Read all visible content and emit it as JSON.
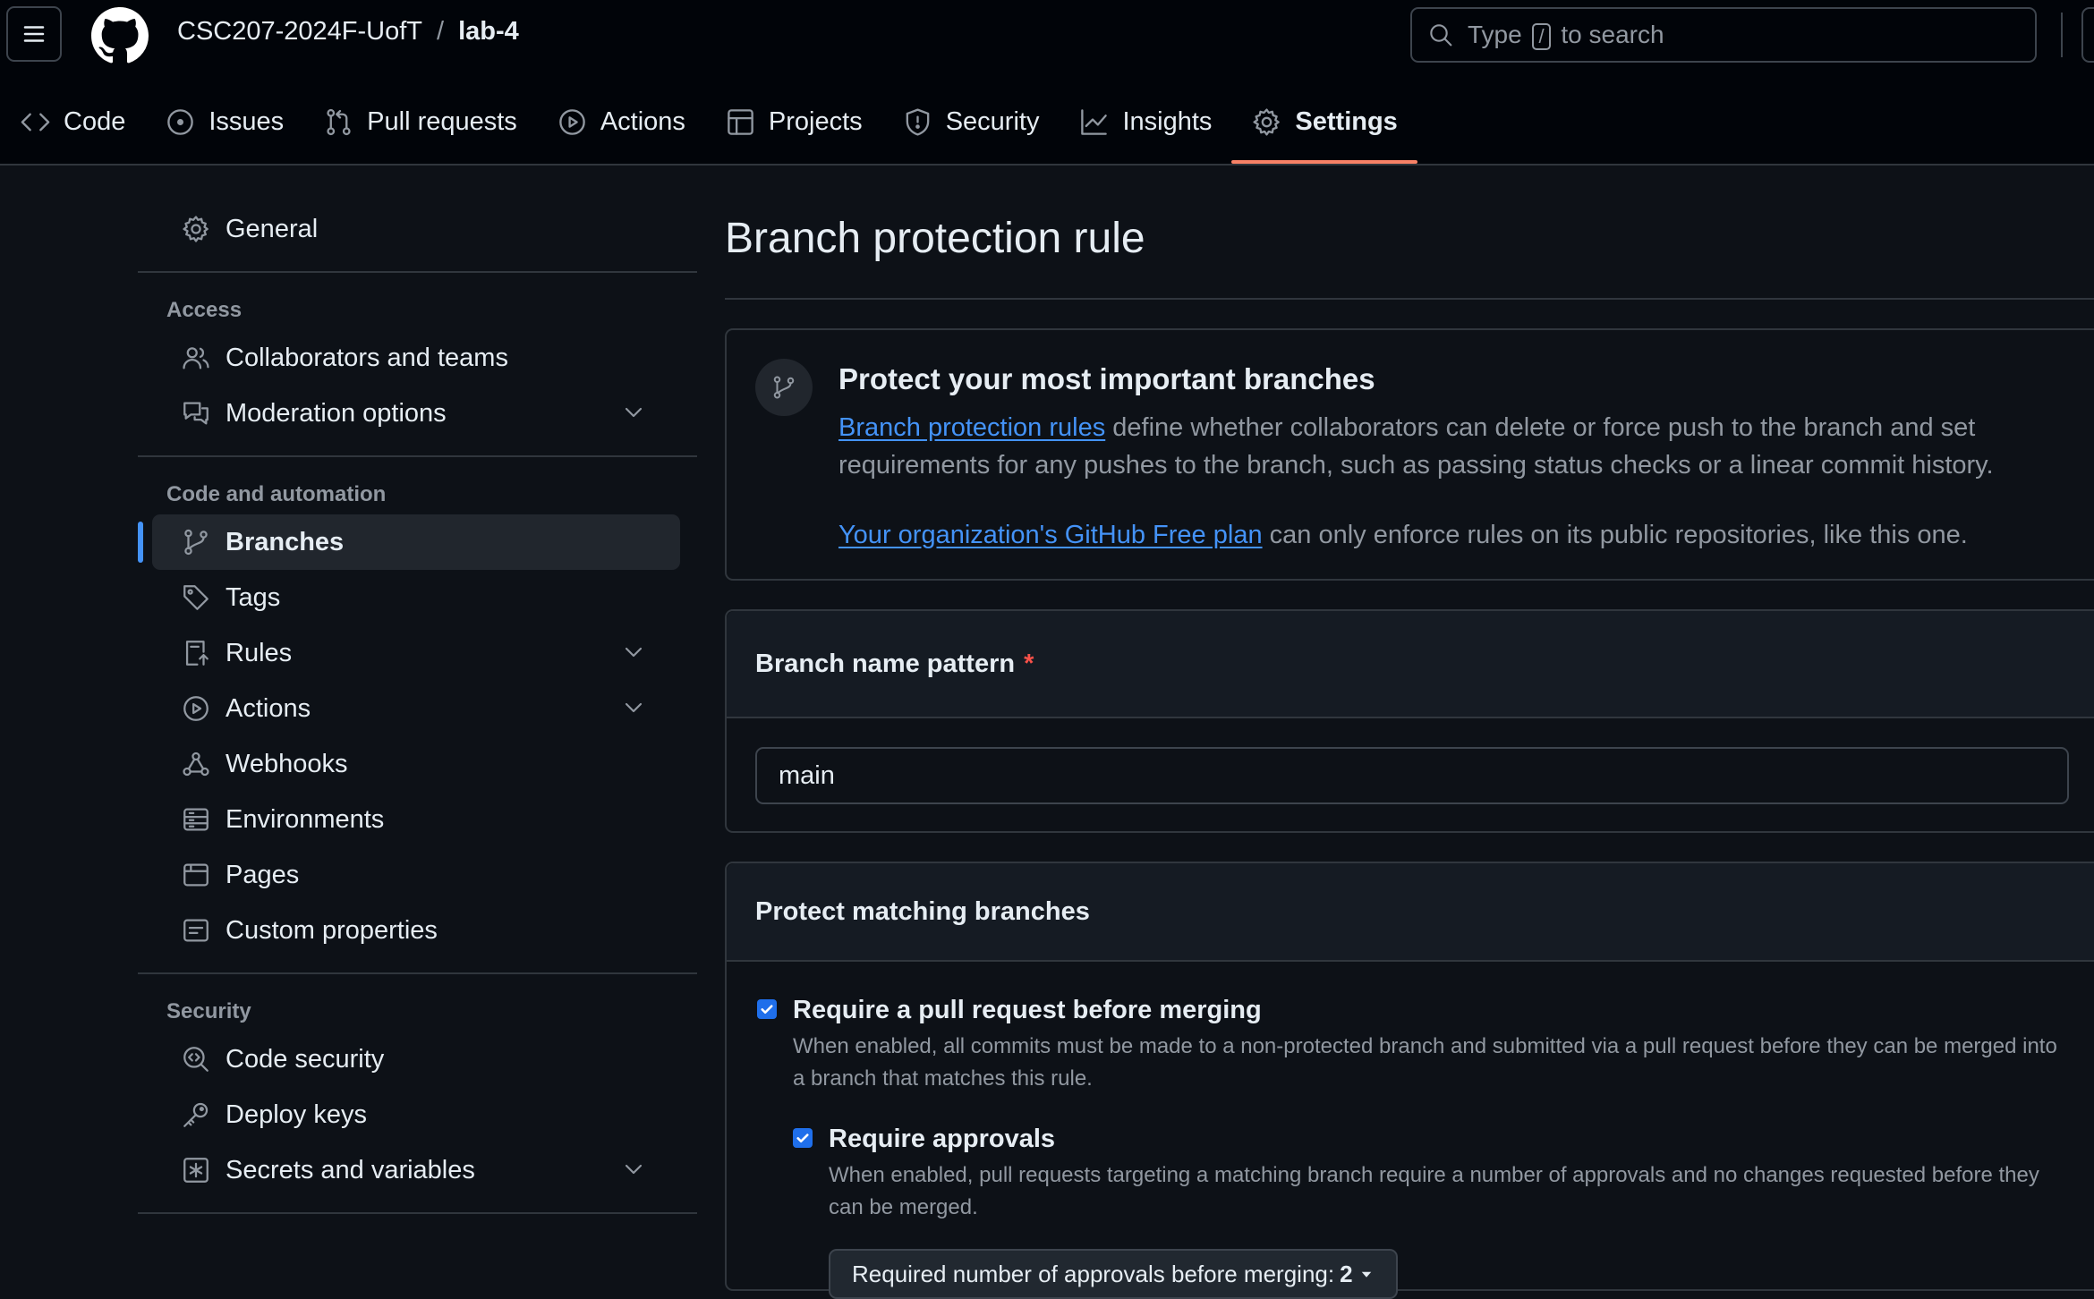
{
  "header": {
    "repo_owner": "CSC207-2024F-UofT",
    "repo_separator": "/",
    "repo_name": "lab-4",
    "search": {
      "prefix": "Type",
      "key": "/",
      "suffix": "to search"
    }
  },
  "repo_nav": {
    "tabs": [
      {
        "label": "Code",
        "icon": "code-icon"
      },
      {
        "label": "Issues",
        "icon": "issue-icon"
      },
      {
        "label": "Pull requests",
        "icon": "pull-request-icon"
      },
      {
        "label": "Actions",
        "icon": "play-icon"
      },
      {
        "label": "Projects",
        "icon": "table-icon"
      },
      {
        "label": "Security",
        "icon": "shield-icon"
      },
      {
        "label": "Insights",
        "icon": "graph-icon"
      },
      {
        "label": "Settings",
        "icon": "gear-icon",
        "active": true
      }
    ]
  },
  "sidebar": {
    "general": "General",
    "access_heading": "Access",
    "access": [
      "Collaborators and teams",
      "Moderation options"
    ],
    "code_heading": "Code and automation",
    "code": [
      "Branches",
      "Tags",
      "Rules",
      "Actions",
      "Webhooks",
      "Environments",
      "Pages",
      "Custom properties"
    ],
    "security_heading": "Security",
    "security": [
      "Code security",
      "Deploy keys",
      "Secrets and variables"
    ]
  },
  "main": {
    "title": "Branch protection rule",
    "info": {
      "heading": "Protect your most important branches",
      "link1": "Branch protection rules",
      "text1": " define whether collaborators can delete or force push to the branch and set requirements for any pushes to the branch, such as passing status checks or a linear commit history.",
      "link2": "Your organization's GitHub Free plan",
      "text2": " can only enforce rules on its public repositories, like this one."
    },
    "pattern": {
      "label": "Branch name pattern",
      "required_mark": "*",
      "value": "main"
    },
    "protect": {
      "heading": "Protect matching branches",
      "require_pr": {
        "checked": true,
        "title": "Require a pull request before merging",
        "desc": "When enabled, all commits must be made to a non-protected branch and submitted via a pull request before they can be merged into a branch that matches this rule."
      },
      "require_approvals": {
        "checked": true,
        "title": "Require approvals",
        "desc": "When enabled, pull requests targeting a matching branch require a number of approvals and no changes requested before they can be merged."
      },
      "approvals_button": {
        "label": "Required number of approvals before merging:",
        "value": "2"
      }
    }
  },
  "colors": {
    "background": "#0d1117",
    "header_bg": "#010409",
    "accent_blue": "#4493f8",
    "active_tab_underline": "#f78166",
    "required_red": "#f85149",
    "checkbox_blue": "#1f6feb"
  }
}
